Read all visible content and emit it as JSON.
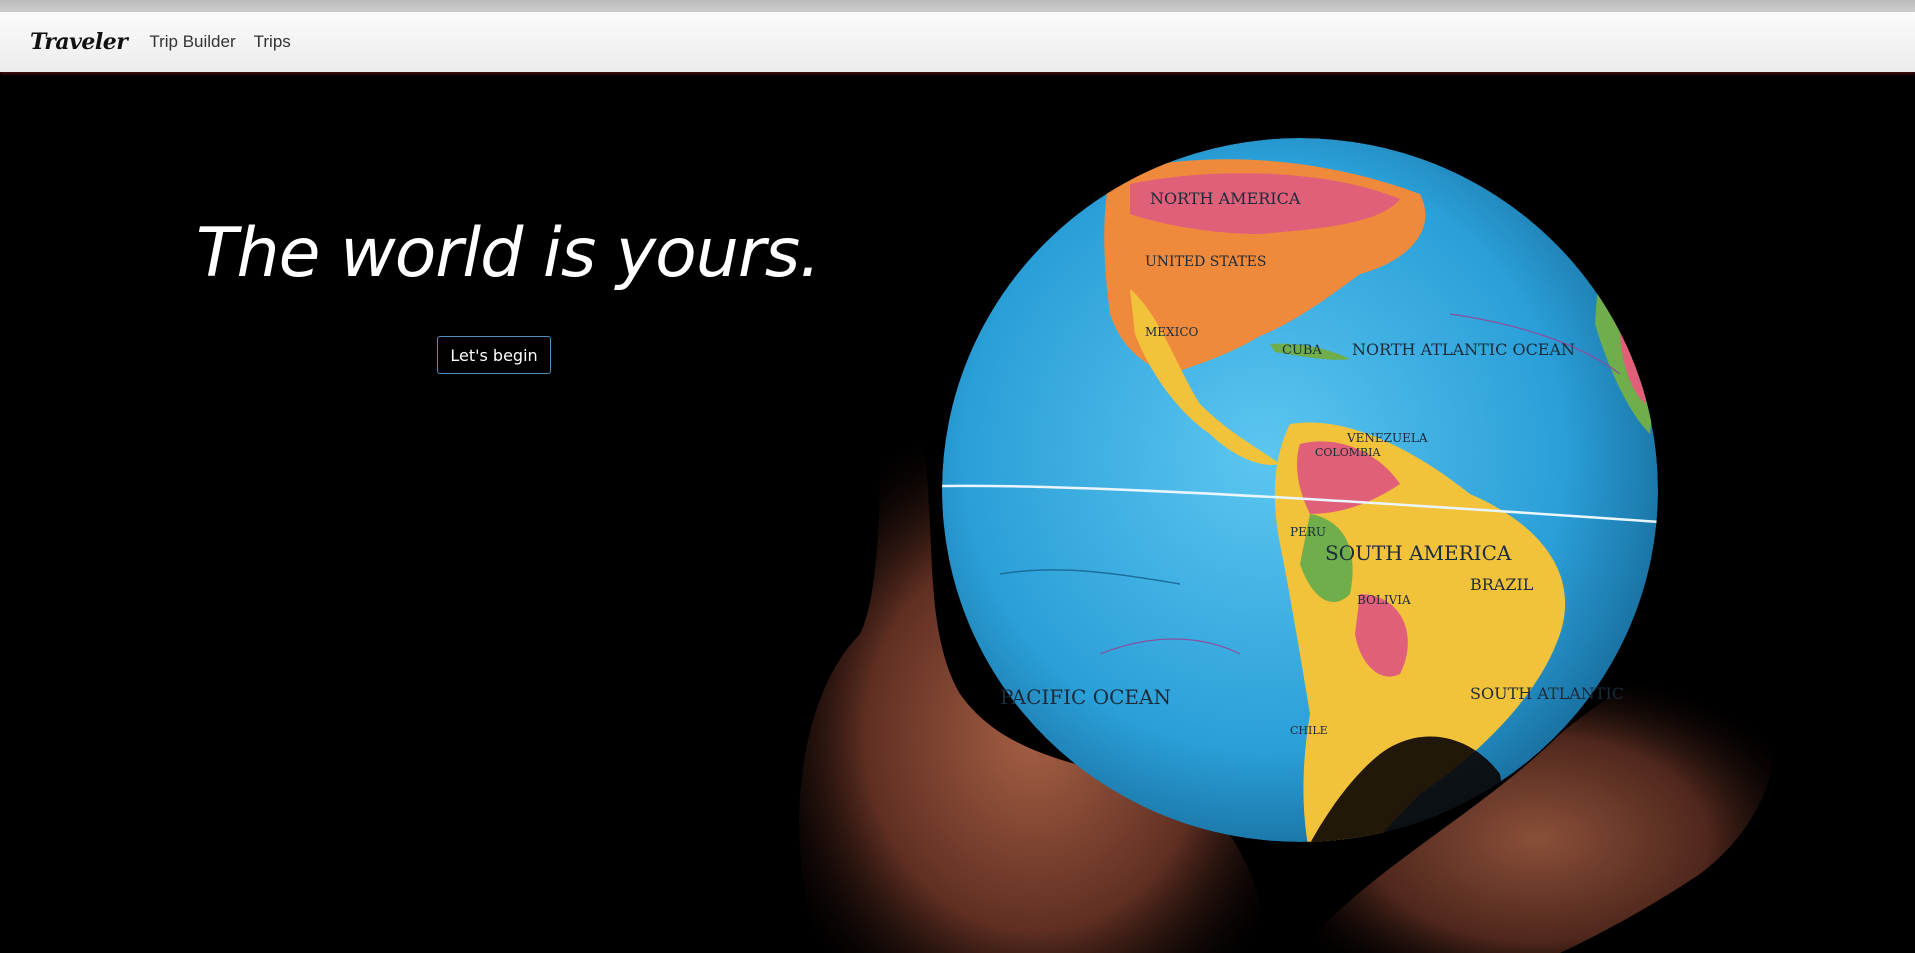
{
  "nav": {
    "brand": "Traveler",
    "links": [
      {
        "label": "Trip Builder"
      },
      {
        "label": "Trips"
      }
    ]
  },
  "hero": {
    "headline": "The world is yours.",
    "cta_label": "Let's begin",
    "globe_labels": {
      "north_america": "NORTH AMERICA",
      "united_states": "UNITED STATES",
      "mexico": "MEXICO",
      "cuba": "CUBA",
      "north_atlantic": "NORTH ATLANTIC OCEAN",
      "venezuela": "VENEZUELA",
      "colombia": "COLOMBIA",
      "peru": "PERU",
      "south_america": "SOUTH AMERICA",
      "brazil": "BRAZIL",
      "bolivia": "BOLIVIA",
      "pacific": "PACIFIC OCEAN",
      "south_atlantic": "SOUTH ATLANTIC",
      "chile": "CHILE"
    }
  },
  "colors": {
    "navbar_bg": "#f4f4f4",
    "hero_bg": "#000000",
    "cta_border": "#4a90b8",
    "ocean": "#2fa3da",
    "land_yellow": "#f2c23a",
    "land_orange": "#ef8a3c",
    "land_green": "#6fae4a",
    "land_pink": "#e0607a"
  }
}
